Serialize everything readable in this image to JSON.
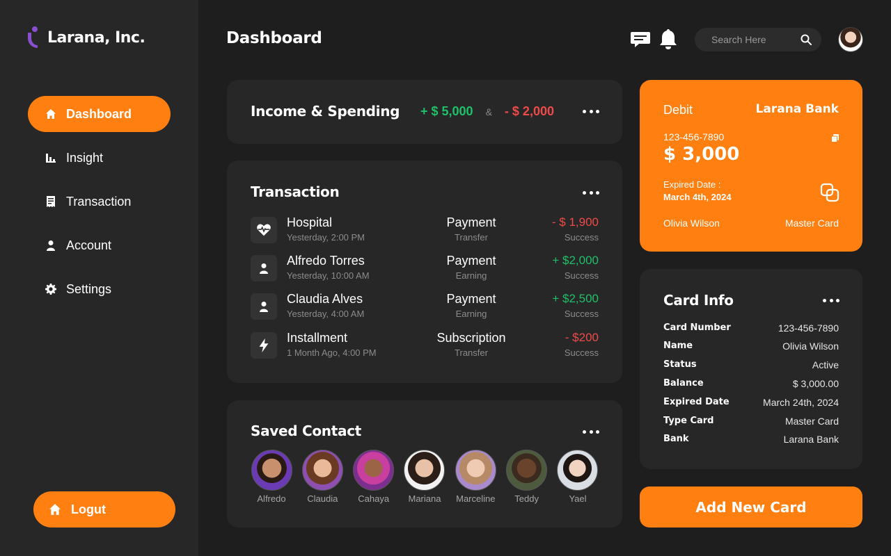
{
  "brand": {
    "name": "Larana, Inc."
  },
  "sidebar": {
    "items": [
      {
        "label": "Dashboard",
        "icon": "home-icon"
      },
      {
        "label": "Insight",
        "icon": "bar-chart-icon"
      },
      {
        "label": "Transaction",
        "icon": "receipt-icon"
      },
      {
        "label": "Account",
        "icon": "user-icon"
      },
      {
        "label": "Settings",
        "icon": "gear-icon"
      }
    ],
    "logout_label": "Logut"
  },
  "header": {
    "title": "Dashboard",
    "search_placeholder": "Search Here"
  },
  "income": {
    "title": "Income & Spending",
    "income_value": "+ $ 5,000",
    "separator": "&",
    "spending_value": "- $ 2,000"
  },
  "transaction": {
    "title": "Transaction",
    "rows": [
      {
        "icon": "heart-pulse-icon",
        "name": "Hospital",
        "time": "Yesterday, 2:00 PM",
        "category": "Payment",
        "type": "Transfer",
        "amount": "- $ 1,900",
        "status": "Success",
        "direction": "out"
      },
      {
        "icon": "user-icon",
        "name": "Alfredo Torres",
        "time": "Yesterday, 10:00 AM",
        "category": "Payment",
        "type": "Earning",
        "amount": "+ $2,000",
        "status": "Success",
        "direction": "in"
      },
      {
        "icon": "user-icon",
        "name": "Claudia Alves",
        "time": "Yesterday, 4:00 AM",
        "category": "Payment",
        "type": "Earning",
        "amount": "+ $2,500",
        "status": "Success",
        "direction": "in"
      },
      {
        "icon": "lightning-icon",
        "name": "Installment",
        "time": "1 Month Ago, 4:00 PM",
        "category": "Subscription",
        "type": "Transfer",
        "amount": "- $200",
        "status": "Success",
        "direction": "out"
      }
    ]
  },
  "contacts": {
    "title": "Saved Contact",
    "people": [
      {
        "name": "Alfredo"
      },
      {
        "name": "Claudia"
      },
      {
        "name": "Cahaya"
      },
      {
        "name": "Mariana"
      },
      {
        "name": "Marceline"
      },
      {
        "name": "Teddy"
      },
      {
        "name": "Yael"
      }
    ]
  },
  "debit_card": {
    "type": "Debit",
    "bank": "Larana Bank",
    "number": "123-456-7890",
    "balance": "$ 3,000",
    "expired_label": "Expired Date :",
    "expired_value": "March 4th, 2024",
    "owner": "Olivia Wilson",
    "network": "Master Card"
  },
  "card_info": {
    "title": "Card Info",
    "rows": [
      {
        "label": "Card Number",
        "value": "123-456-7890"
      },
      {
        "label": "Name",
        "value": "Olivia Wilson"
      },
      {
        "label": "Status",
        "value": "Active"
      },
      {
        "label": "Balance",
        "value": "$ 3,000.00"
      },
      {
        "label": "Expired Date",
        "value": "March 24th, 2024"
      },
      {
        "label": "Type Card",
        "value": "Master Card"
      },
      {
        "label": "Bank",
        "value": "Larana Bank"
      }
    ]
  },
  "add_card_label": "Add New Card",
  "colors": {
    "accent": "#ff8010",
    "background": "#1e1e1e",
    "panel": "#272727",
    "positive": "#1fc06a",
    "negative": "#ef4a4a",
    "brand_mark": "#8a4fd1"
  }
}
